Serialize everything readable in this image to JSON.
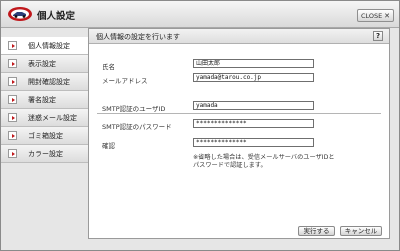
{
  "window": {
    "title": "個人設定",
    "close_label": "CLOSE",
    "close_symbol": "✕"
  },
  "sidebar": {
    "items": [
      {
        "label": "個人情報設定",
        "active": true
      },
      {
        "label": "表示設定",
        "active": false
      },
      {
        "label": "開封確認設定",
        "active": false
      },
      {
        "label": "署名設定",
        "active": false
      },
      {
        "label": "迷惑メール設定",
        "active": false
      },
      {
        "label": "ゴミ箱設定",
        "active": false
      },
      {
        "label": "カラー設定",
        "active": false
      }
    ]
  },
  "panel": {
    "title": "個人情報の設定を行います",
    "help_label": "?",
    "name_label": "氏名",
    "name_value": "山田太郎",
    "email_label": "メールアドレス",
    "email_value": "yamada@tarou.co.jp",
    "smtp_user_label": "SMTP認証のユーザID",
    "smtp_user_value": "yamada",
    "smtp_pass_label": "SMTP認証のパスワード",
    "smtp_pass_value": "**************",
    "confirm_label": "確認",
    "confirm_value": "**************",
    "note_line1": "※省略した場合は、受信メールサーバのユーザIDと",
    "note_line2": "パスワードで認証します。",
    "execute_label": "実行する",
    "cancel_label": "キャンセル"
  },
  "colors": {
    "accent_red": "#c0181c",
    "panel_bg": "#ffffff",
    "window_bg": "#e6e6e6"
  }
}
